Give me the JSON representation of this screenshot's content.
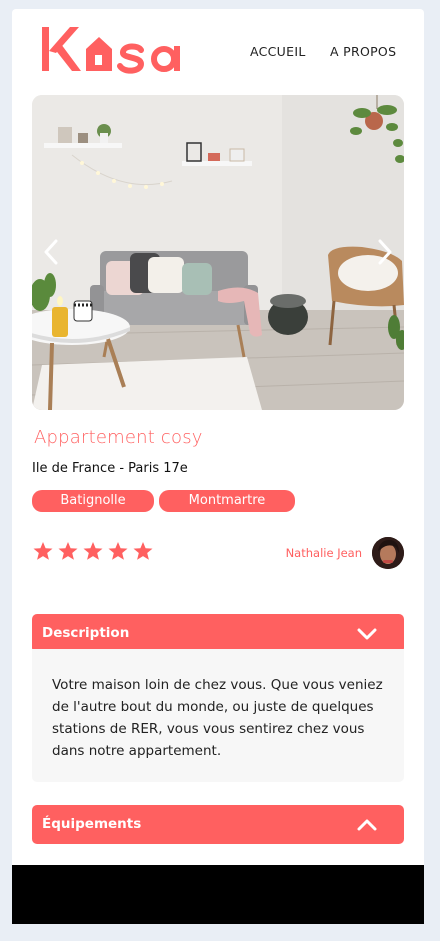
{
  "brand": {
    "logo_text": "Kasa",
    "accent": "#ff6060"
  },
  "nav": {
    "home_label": "ACCUEIL",
    "about_label": "A PROPOS"
  },
  "gallery": {
    "prev_icon": "chevron-left-icon",
    "next_icon": "chevron-right-icon"
  },
  "listing": {
    "title": "Appartement cosy",
    "location": "Ile de France - Paris 17e",
    "tags": [
      "Batignolle",
      "Montmartre"
    ],
    "rating": 5,
    "rating_max": 5,
    "host_name": "Nathalie Jean"
  },
  "collapses": {
    "description": {
      "label": "Description",
      "icon": "chevron-down-icon",
      "text": "Votre maison loin de chez vous. Que vous veniez de l'autre bout du monde, ou juste de quelques stations de RER, vous vous sentirez chez vous dans notre appartement."
    },
    "equipment": {
      "label": "Équipements",
      "icon": "chevron-up-icon"
    }
  }
}
